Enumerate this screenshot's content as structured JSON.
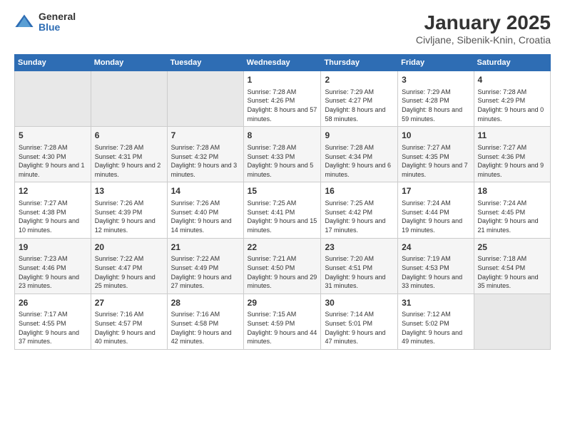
{
  "header": {
    "logo_general": "General",
    "logo_blue": "Blue",
    "title": "January 2025",
    "subtitle": "Civljane, Sibenik-Knin, Croatia"
  },
  "days_header": [
    "Sunday",
    "Monday",
    "Tuesday",
    "Wednesday",
    "Thursday",
    "Friday",
    "Saturday"
  ],
  "weeks": [
    {
      "cells": [
        {
          "day": "",
          "content": ""
        },
        {
          "day": "",
          "content": ""
        },
        {
          "day": "",
          "content": ""
        },
        {
          "day": "1",
          "content": "Sunrise: 7:28 AM\nSunset: 4:26 PM\nDaylight: 8 hours and 57 minutes."
        },
        {
          "day": "2",
          "content": "Sunrise: 7:29 AM\nSunset: 4:27 PM\nDaylight: 8 hours and 58 minutes."
        },
        {
          "day": "3",
          "content": "Sunrise: 7:29 AM\nSunset: 4:28 PM\nDaylight: 8 hours and 59 minutes."
        },
        {
          "day": "4",
          "content": "Sunrise: 7:28 AM\nSunset: 4:29 PM\nDaylight: 9 hours and 0 minutes."
        }
      ]
    },
    {
      "cells": [
        {
          "day": "5",
          "content": "Sunrise: 7:28 AM\nSunset: 4:30 PM\nDaylight: 9 hours and 1 minute."
        },
        {
          "day": "6",
          "content": "Sunrise: 7:28 AM\nSunset: 4:31 PM\nDaylight: 9 hours and 2 minutes."
        },
        {
          "day": "7",
          "content": "Sunrise: 7:28 AM\nSunset: 4:32 PM\nDaylight: 9 hours and 3 minutes."
        },
        {
          "day": "8",
          "content": "Sunrise: 7:28 AM\nSunset: 4:33 PM\nDaylight: 9 hours and 5 minutes."
        },
        {
          "day": "9",
          "content": "Sunrise: 7:28 AM\nSunset: 4:34 PM\nDaylight: 9 hours and 6 minutes."
        },
        {
          "day": "10",
          "content": "Sunrise: 7:27 AM\nSunset: 4:35 PM\nDaylight: 9 hours and 7 minutes."
        },
        {
          "day": "11",
          "content": "Sunrise: 7:27 AM\nSunset: 4:36 PM\nDaylight: 9 hours and 9 minutes."
        }
      ]
    },
    {
      "cells": [
        {
          "day": "12",
          "content": "Sunrise: 7:27 AM\nSunset: 4:38 PM\nDaylight: 9 hours and 10 minutes."
        },
        {
          "day": "13",
          "content": "Sunrise: 7:26 AM\nSunset: 4:39 PM\nDaylight: 9 hours and 12 minutes."
        },
        {
          "day": "14",
          "content": "Sunrise: 7:26 AM\nSunset: 4:40 PM\nDaylight: 9 hours and 14 minutes."
        },
        {
          "day": "15",
          "content": "Sunrise: 7:25 AM\nSunset: 4:41 PM\nDaylight: 9 hours and 15 minutes."
        },
        {
          "day": "16",
          "content": "Sunrise: 7:25 AM\nSunset: 4:42 PM\nDaylight: 9 hours and 17 minutes."
        },
        {
          "day": "17",
          "content": "Sunrise: 7:24 AM\nSunset: 4:44 PM\nDaylight: 9 hours and 19 minutes."
        },
        {
          "day": "18",
          "content": "Sunrise: 7:24 AM\nSunset: 4:45 PM\nDaylight: 9 hours and 21 minutes."
        }
      ]
    },
    {
      "cells": [
        {
          "day": "19",
          "content": "Sunrise: 7:23 AM\nSunset: 4:46 PM\nDaylight: 9 hours and 23 minutes."
        },
        {
          "day": "20",
          "content": "Sunrise: 7:22 AM\nSunset: 4:47 PM\nDaylight: 9 hours and 25 minutes."
        },
        {
          "day": "21",
          "content": "Sunrise: 7:22 AM\nSunset: 4:49 PM\nDaylight: 9 hours and 27 minutes."
        },
        {
          "day": "22",
          "content": "Sunrise: 7:21 AM\nSunset: 4:50 PM\nDaylight: 9 hours and 29 minutes."
        },
        {
          "day": "23",
          "content": "Sunrise: 7:20 AM\nSunset: 4:51 PM\nDaylight: 9 hours and 31 minutes."
        },
        {
          "day": "24",
          "content": "Sunrise: 7:19 AM\nSunset: 4:53 PM\nDaylight: 9 hours and 33 minutes."
        },
        {
          "day": "25",
          "content": "Sunrise: 7:18 AM\nSunset: 4:54 PM\nDaylight: 9 hours and 35 minutes."
        }
      ]
    },
    {
      "cells": [
        {
          "day": "26",
          "content": "Sunrise: 7:17 AM\nSunset: 4:55 PM\nDaylight: 9 hours and 37 minutes."
        },
        {
          "day": "27",
          "content": "Sunrise: 7:16 AM\nSunset: 4:57 PM\nDaylight: 9 hours and 40 minutes."
        },
        {
          "day": "28",
          "content": "Sunrise: 7:16 AM\nSunset: 4:58 PM\nDaylight: 9 hours and 42 minutes."
        },
        {
          "day": "29",
          "content": "Sunrise: 7:15 AM\nSunset: 4:59 PM\nDaylight: 9 hours and 44 minutes."
        },
        {
          "day": "30",
          "content": "Sunrise: 7:14 AM\nSunset: 5:01 PM\nDaylight: 9 hours and 47 minutes."
        },
        {
          "day": "31",
          "content": "Sunrise: 7:12 AM\nSunset: 5:02 PM\nDaylight: 9 hours and 49 minutes."
        },
        {
          "day": "",
          "content": ""
        }
      ]
    }
  ]
}
